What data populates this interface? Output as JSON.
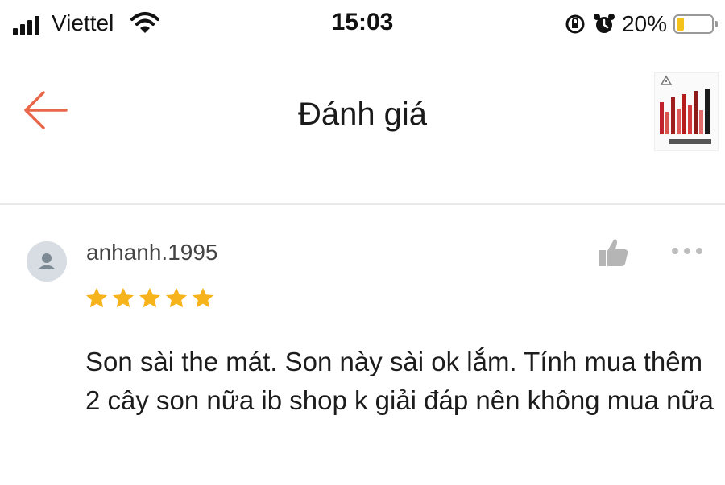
{
  "status_bar": {
    "carrier": "Viettel",
    "time": "15:03",
    "battery_percent_text": "20%",
    "battery_level": 0.2,
    "icons": [
      "signal-icon",
      "wifi-icon",
      "orientation-lock-icon",
      "alarm-icon",
      "battery-icon"
    ]
  },
  "header": {
    "title": "Đánh giá",
    "back_icon": "arrow-left-icon",
    "accent_color": "#e8674a"
  },
  "review": {
    "username": "anhanh.1995",
    "rating": 5,
    "max_rating": 5,
    "star_color": "#f6b31b",
    "comment": "Son sài the mát. Son này sài ok lắm. Tính mua thêm 2 cây son nữa ib shop k giải đáp nên không mua nữa",
    "icons": [
      "avatar-icon",
      "thumbs-up-icon",
      "more-icon"
    ]
  }
}
